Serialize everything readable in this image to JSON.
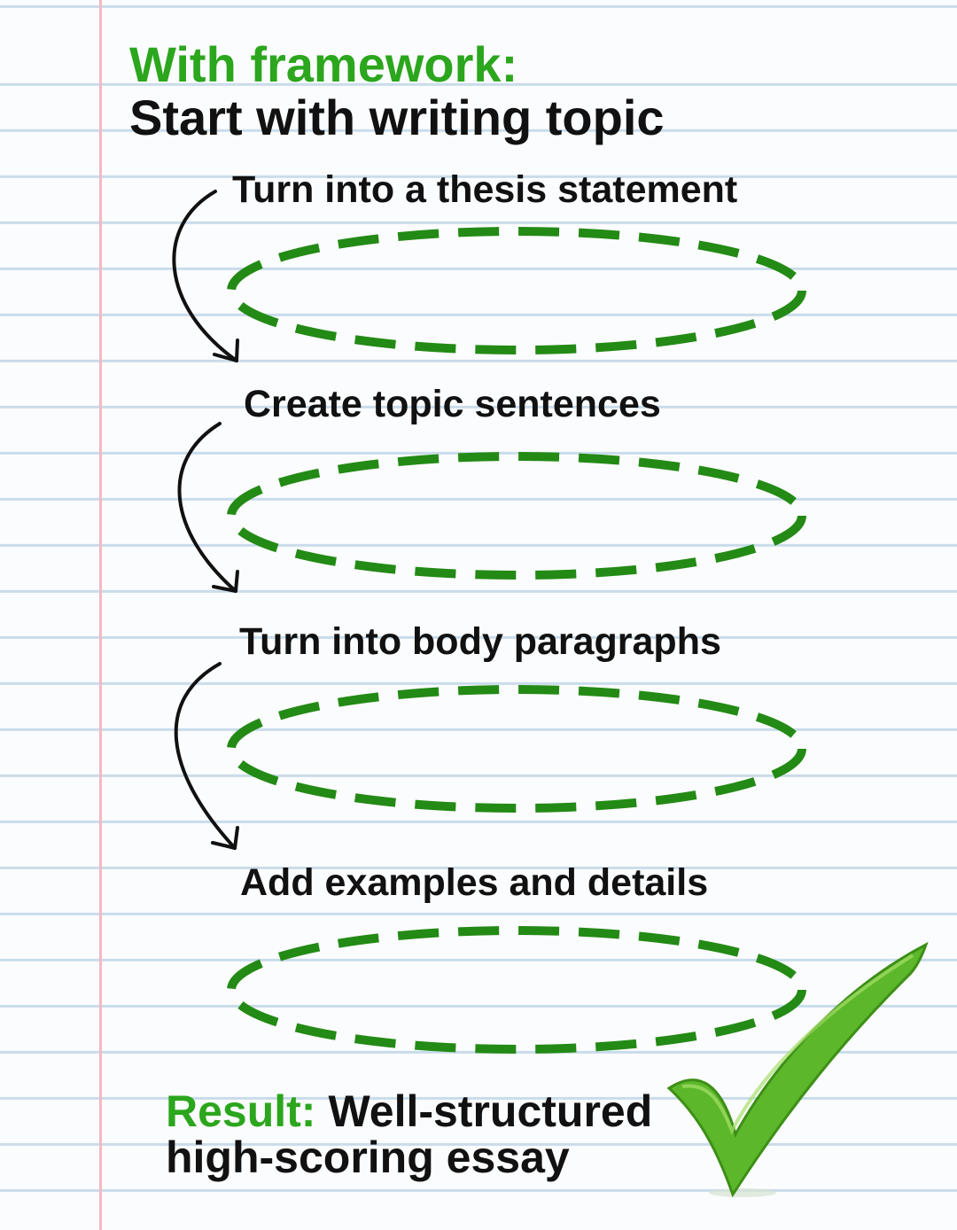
{
  "colors": {
    "accent_green": "#2ba61d",
    "oval_green": "#238a15",
    "text_dark": "#111111",
    "rule_blue": "#c9dceb",
    "margin_pink": "#f2b9c3",
    "check_green": "#5cb82a"
  },
  "header": {
    "title_prefix": "With framework:",
    "title_main": "Start with writing topic"
  },
  "steps": [
    {
      "label": "Turn into a thesis statement"
    },
    {
      "label": "Create topic sentences"
    },
    {
      "label": "Turn into body paragraphs"
    },
    {
      "label": "Add examples and details"
    }
  ],
  "result": {
    "label": "Result:",
    "text_line1": "Well-structured",
    "text_line2": "high-scoring essay"
  },
  "icons": {
    "arrow": "curved-down-arrow-icon",
    "check": "green-checkmark-icon"
  }
}
